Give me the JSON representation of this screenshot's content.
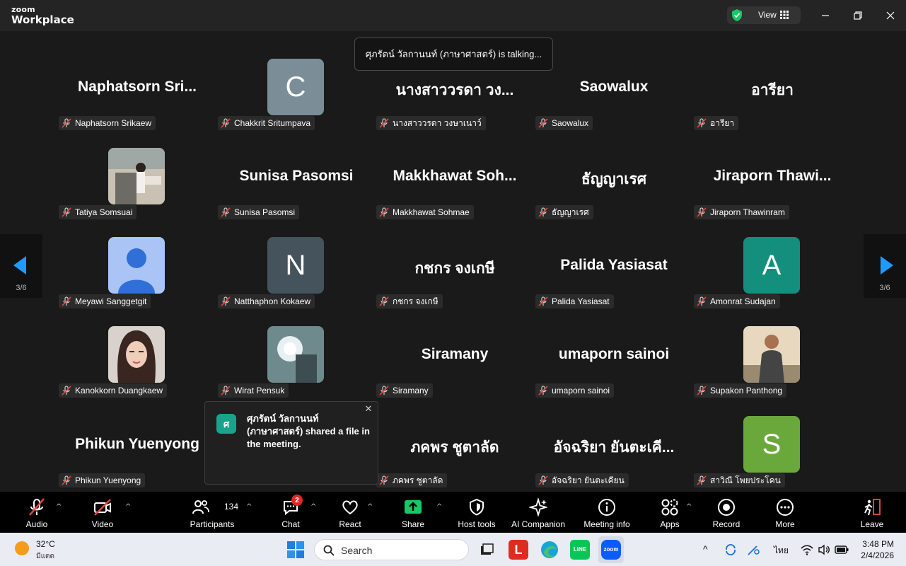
{
  "app": {
    "brand_small": "zoom",
    "brand_big": "Workplace",
    "view_label": "View"
  },
  "talking": {
    "text": "ศุภรัตน์ วัลกานนท์ (ภาษาศาสตร์) is talking..."
  },
  "pager": {
    "left_page": "3/6",
    "right_page": "3/6"
  },
  "participants": [
    {
      "display": "Naphatsorn  Sri...",
      "label": "Naphatsorn Srikaew"
    },
    {
      "avatar_letter": "C",
      "avatar_color": "#7b8d97",
      "label": "Chakkrit Sritumpava"
    },
    {
      "display": "นางสาววรดา วง...",
      "label": "นางสาววรดา วงษาเนาว์"
    },
    {
      "display": "Saowalux",
      "label": "Saowalux"
    },
    {
      "display": "อารียา",
      "label": "อารียา"
    },
    {
      "photo": "photo-room",
      "label": "Tatiya Somsuai"
    },
    {
      "display": "Sunisa Pasomsi",
      "label": "Sunisa Pasomsi"
    },
    {
      "display": "Makkhawat  Soh...",
      "label": "Makkhawat Sohmae"
    },
    {
      "display": "ธัญญาเรศ",
      "label": "ธัญญาเรศ"
    },
    {
      "display": "Jiraporn  Thawi...",
      "label": "Jiraporn Thawinram"
    },
    {
      "photo": "default-person",
      "label": "Meyawi Sanggetgit"
    },
    {
      "avatar_letter": "N",
      "avatar_color": "#44535c",
      "label": "Natthaphon Kokaew"
    },
    {
      "display": "กชกร จงเกษี",
      "label": "กชกร จงเกษี"
    },
    {
      "display": "Palida Yasiasat",
      "label": "Palida Yasiasat"
    },
    {
      "avatar_letter": "A",
      "avatar_color": "#148f7e",
      "label": "Amonrat Sudajan"
    },
    {
      "photo": "photo-girl",
      "label": "Kanokkorn Duangkaew"
    },
    {
      "photo": "photo-blurred",
      "label": "Wirat Pensuk"
    },
    {
      "display": "Siramany",
      "label": "Siramany"
    },
    {
      "display": "umaporn sainoi",
      "label": "umaporn sainoi"
    },
    {
      "photo": "photo-man",
      "label": "Supakon Panthong"
    },
    {
      "display": "Phikun Yuenyong",
      "label": "Phikun Yuenyong"
    },
    {
      "hidden": true,
      "label": ""
    },
    {
      "display": "ภคพร ชูตาลัด",
      "label": "ภคพร ชูตาลัด"
    },
    {
      "display": "อัจฉริยา ยันตะเคี...",
      "label": "อัจฉริยา ยันตะเคียน"
    },
    {
      "avatar_letter": "S",
      "avatar_color": "#6aa83c",
      "label": "สาวิณี โพยประโคน"
    }
  ],
  "notification": {
    "avatar_letter": "ศ",
    "text": "ศุภรัตน์ วัลกานนท์ (ภาษาศาสตร์) shared a file in the meeting."
  },
  "toolbar": {
    "audio": "Audio",
    "video": "Video",
    "participants": "Participants",
    "participants_count": "134",
    "chat": "Chat",
    "chat_badge": "2",
    "react": "React",
    "share": "Share",
    "host_tools": "Host tools",
    "ai_companion": "AI Companion",
    "meeting_info": "Meeting info",
    "apps": "Apps",
    "record": "Record",
    "more": "More",
    "leave": "Leave"
  },
  "taskbar": {
    "temperature": "32°C",
    "condition": "มีแดด",
    "search_placeholder": "Search",
    "language": "ไทย",
    "time": "3:48 PM",
    "date": "2/4/2026"
  },
  "colors": {
    "accent_green": "#17c964",
    "muted_red": "#e0443e",
    "arrow_blue": "#1e9bff"
  }
}
